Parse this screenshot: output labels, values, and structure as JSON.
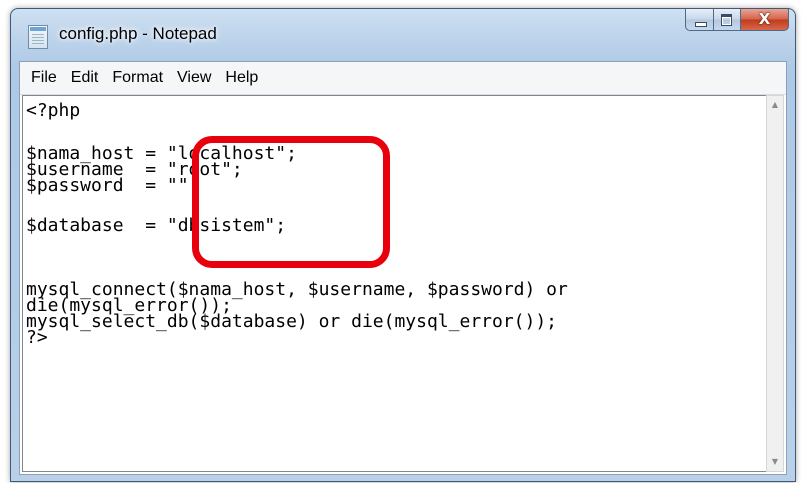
{
  "window": {
    "title": "config.php - Notepad",
    "icon": "notepad-icon"
  },
  "caption_buttons": {
    "minimize_icon": "minimize-icon",
    "maximize_icon": "maximize-icon",
    "close_glyph": "X"
  },
  "menu": {
    "items": [
      "File",
      "Edit",
      "Format",
      "View",
      "Help"
    ]
  },
  "editor": {
    "lines": [
      "<?php",
      "",
      "$nama_host = \"localhost\";",
      "$username  = \"root\";",
      "$password  = \"\";",
      "",
      "$database  = \"dbsistem\";",
      "",
      "",
      "mysql_connect($nama_host, $username, $password) or",
      "die(mysql_error());",
      "mysql_select_db($database) or die(mysql_error());",
      "?>"
    ]
  },
  "scrollbar": {
    "up_arrow": "▲",
    "down_arrow": "▼"
  },
  "annotation": {
    "highlight_color": "#e8000c"
  }
}
